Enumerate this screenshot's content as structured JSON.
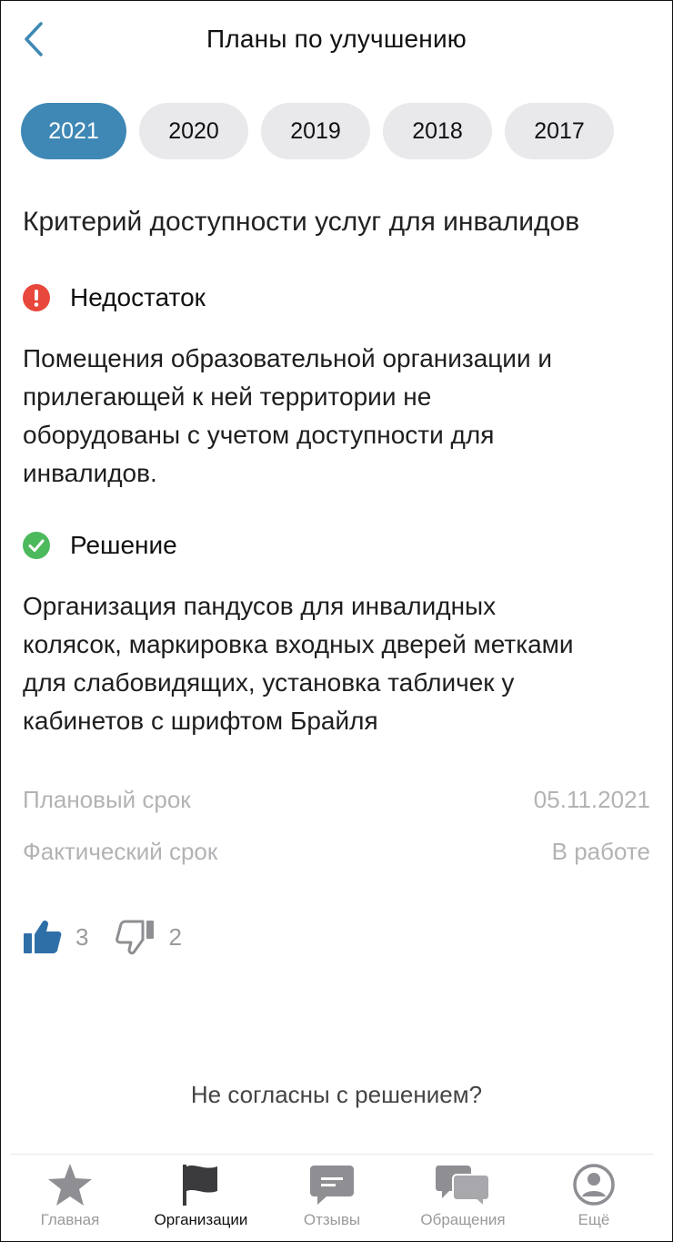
{
  "header": {
    "title": "Планы по улучшению",
    "back_icon": "chevron-left-icon"
  },
  "years": {
    "active": "2021",
    "items": [
      "2021",
      "2020",
      "2019",
      "2018",
      "2017"
    ]
  },
  "criterion": {
    "title": "Критерий доступности услуг для инвалидов"
  },
  "shortcoming": {
    "label": "Недостаток",
    "icon": "exclamation-icon",
    "color": "#e8473b",
    "lines": [
      "Помещения образовательной организации и",
      "прилегающей к ней территории не",
      "оборудованы с учетом доступности для",
      "инвалидов."
    ]
  },
  "solution": {
    "label": "Решение",
    "icon": "check-icon",
    "color": "#4cba5c",
    "lines": [
      "Организация пандусов для инвалидных",
      "колясок, маркировка входных дверей метками",
      "для слабовидящих, установка табличек у",
      "кабинетов с шрифтом Брайля"
    ]
  },
  "dates": {
    "planned_label": "Плановый срок",
    "planned_value": "05.11.2021",
    "actual_label": "Фактический срок",
    "actual_value": "В работе"
  },
  "votes": {
    "likes": "3",
    "dislikes": "2"
  },
  "disagree_link": "Не согласны с решением?",
  "tabs": [
    {
      "label": "Главная",
      "icon": "star-icon"
    },
    {
      "label": "Организации",
      "icon": "flag-icon",
      "active": true
    },
    {
      "label": "Отзывы",
      "icon": "comment-icon"
    },
    {
      "label": "Обращения",
      "icon": "chat-bubbles-icon"
    },
    {
      "label": "Ещё",
      "icon": "user-circle-icon"
    }
  ],
  "colors": {
    "accent": "#3f88b5",
    "pill_bg": "#e9e9ec",
    "muted": "#b3b3b6",
    "like": "#2f6fa8"
  }
}
